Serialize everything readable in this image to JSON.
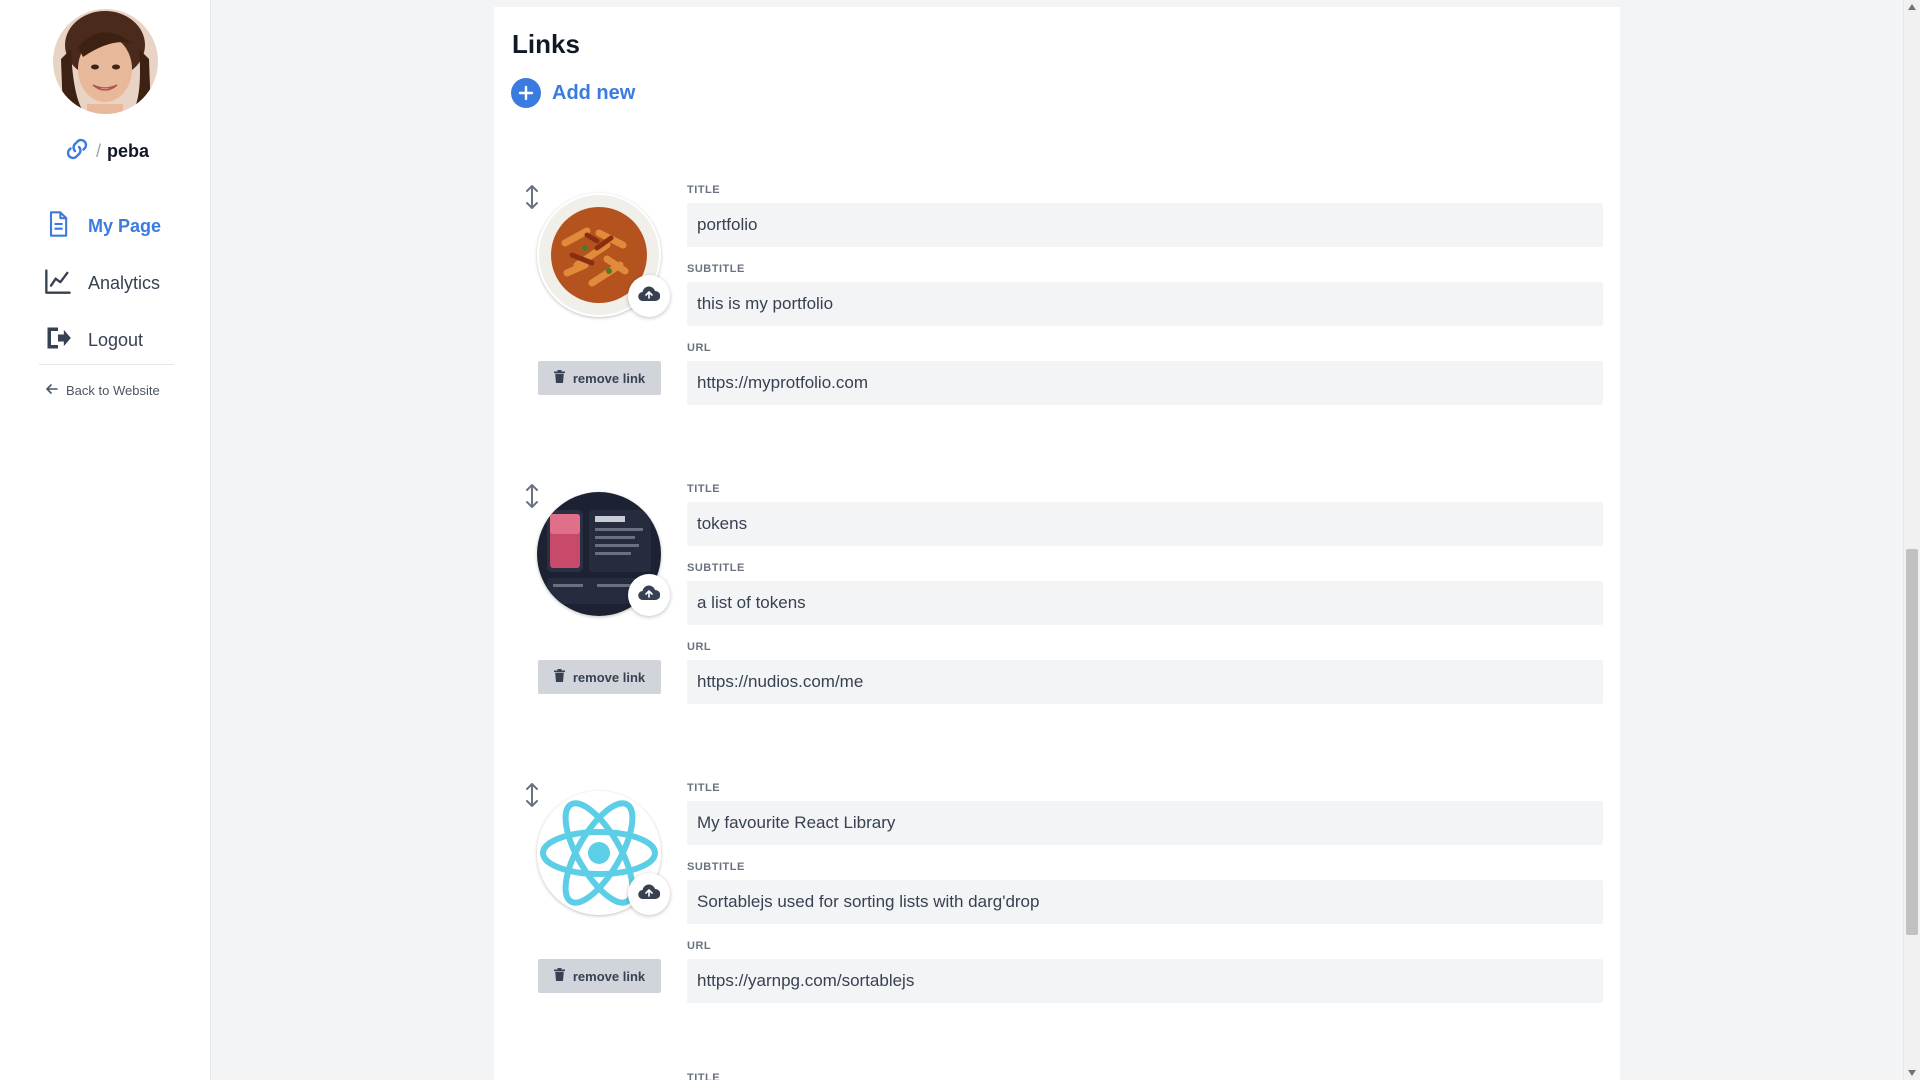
{
  "sidebar": {
    "username": "peba",
    "nav": [
      {
        "label": "My Page",
        "icon": "document-icon",
        "active": true
      },
      {
        "label": "Analytics",
        "icon": "chart-line-icon",
        "active": false
      },
      {
        "label": "Logout",
        "icon": "logout-icon",
        "active": false
      }
    ],
    "back_label": "Back to Website"
  },
  "main": {
    "title": "Links",
    "add_label": "Add new",
    "field_labels": {
      "title": "TITLE",
      "subtitle": "SUBTITLE",
      "url": "URL"
    },
    "remove_label": "remove link",
    "links": [
      {
        "title": "portfolio",
        "subtitle": "this is my portfolio",
        "url": "https://myprotfolio.com",
        "thumbnail": "pasta-photo"
      },
      {
        "title": "tokens",
        "subtitle": "a list of tokens",
        "url": "https://nudios.com/me",
        "thumbnail": "app-screenshot"
      },
      {
        "title": "My favourite React Library",
        "subtitle": "Sortablejs used for sorting lists with darg'drop",
        "url": "https://yarnpg.com/sortablejs",
        "thumbnail": "react-logo"
      }
    ],
    "next_item_label": "TITLE"
  },
  "colors": {
    "accent": "#3b7be0",
    "input_bg": "#f3f4f6",
    "remove_bg": "#d1d5db"
  }
}
